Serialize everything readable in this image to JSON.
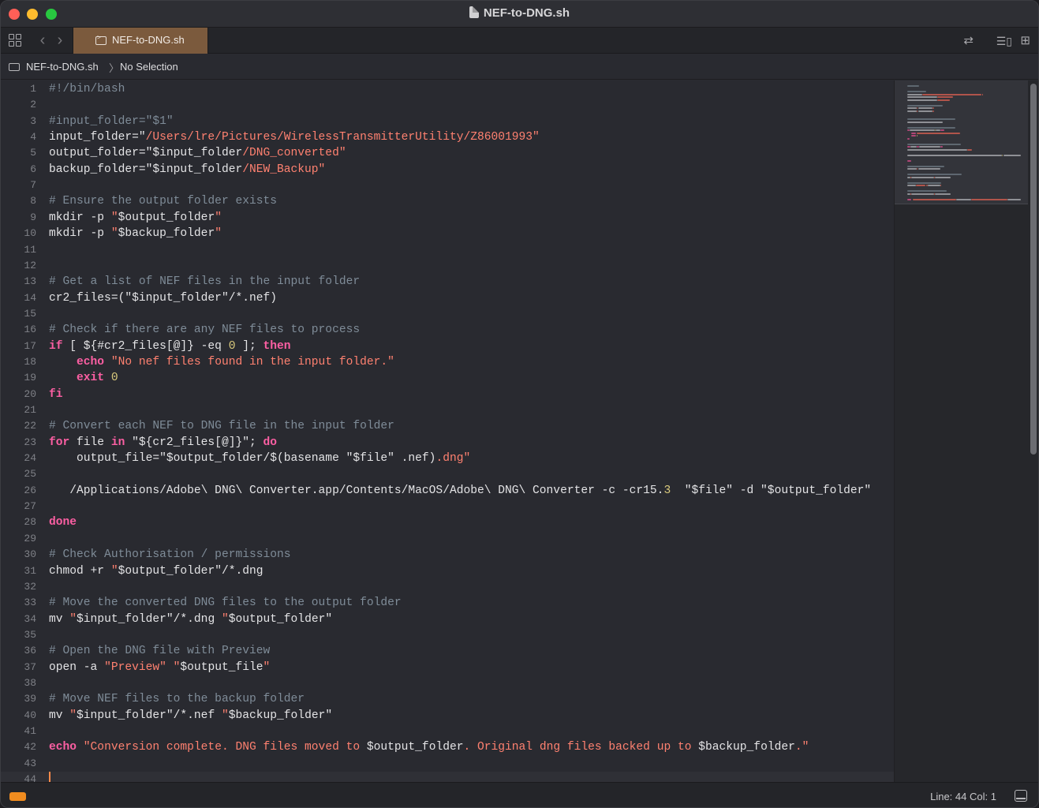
{
  "window": {
    "title": "NEF-to-DNG.sh"
  },
  "tabs": [
    {
      "label": "NEF-to-DNG.sh",
      "active": true
    }
  ],
  "breadcrumb": {
    "file": "NEF-to-DNG.sh",
    "separator": "〉",
    "selection": "No Selection"
  },
  "status": {
    "line_label": "Line:",
    "line": "44",
    "col_label": "Col:",
    "col": "1"
  },
  "colors": {
    "tab_active": "#7b5a3d",
    "comment": "#7f8c98",
    "string": "#ff8170",
    "keyword": "#fc5fa3",
    "number": "#d9c97c",
    "caret": "#ff8a4a"
  },
  "icons": [
    "document-icon",
    "grid-icon",
    "back-icon",
    "forward-icon",
    "terminal-file-icon",
    "swap-icon",
    "minimap-toggle-icon",
    "add-editor-icon",
    "panel-icon"
  ],
  "editor": {
    "current_line": 44,
    "lines": [
      {
        "n": "1",
        "tokens": [
          [
            "cmt",
            "#!/bin/bash"
          ]
        ]
      },
      {
        "n": "2",
        "tokens": []
      },
      {
        "n": "3",
        "tokens": [
          [
            "cmt",
            "#input_folder=\"$1\""
          ]
        ]
      },
      {
        "n": "4",
        "tokens": [
          [
            "pl",
            "input_folder=\""
          ],
          [
            "str",
            "/Users/lre/Pictures/WirelessTransmitterUtility/Z86001993"
          ],
          [
            "str",
            "\""
          ]
        ]
      },
      {
        "n": "5",
        "tokens": [
          [
            "pl",
            "output_folder=\"$input_folder"
          ],
          [
            "str",
            "/DNG_converted\""
          ]
        ]
      },
      {
        "n": "6",
        "tokens": [
          [
            "pl",
            "backup_folder=\"$input_folder"
          ],
          [
            "str",
            "/NEW_Backup\""
          ]
        ]
      },
      {
        "n": "7",
        "tokens": []
      },
      {
        "n": "8",
        "tokens": [
          [
            "cmt",
            "# Ensure the output folder exists"
          ]
        ]
      },
      {
        "n": "9",
        "tokens": [
          [
            "pl",
            "mkdir -p "
          ],
          [
            "str",
            "\""
          ],
          [
            "pl",
            "$output_folder"
          ],
          [
            "str",
            "\""
          ]
        ]
      },
      {
        "n": "10",
        "tokens": [
          [
            "pl",
            "mkdir -p "
          ],
          [
            "str",
            "\""
          ],
          [
            "pl",
            "$backup_folder"
          ],
          [
            "str",
            "\""
          ]
        ]
      },
      {
        "n": "11",
        "tokens": []
      },
      {
        "n": "12",
        "tokens": []
      },
      {
        "n": "13",
        "tokens": [
          [
            "cmt",
            "# Get a list of NEF files in the input folder"
          ]
        ]
      },
      {
        "n": "14",
        "tokens": [
          [
            "pl",
            "cr2_files=(\"$input_folder\"/*.nef)"
          ]
        ]
      },
      {
        "n": "15",
        "tokens": []
      },
      {
        "n": "16",
        "tokens": [
          [
            "cmt",
            "# Check if there are any NEF files to process"
          ]
        ]
      },
      {
        "n": "17",
        "tokens": [
          [
            "kw",
            "if"
          ],
          [
            "pl",
            " [ ${#cr2_files[@]} -eq "
          ],
          [
            "num",
            "0"
          ],
          [
            "pl",
            " ]; "
          ],
          [
            "kw",
            "then"
          ]
        ]
      },
      {
        "n": "18",
        "tokens": [
          [
            "pl",
            "    "
          ],
          [
            "kw",
            "echo"
          ],
          [
            "pl",
            " "
          ],
          [
            "str",
            "\"No nef files found in the input folder.\""
          ]
        ]
      },
      {
        "n": "19",
        "tokens": [
          [
            "pl",
            "    "
          ],
          [
            "kw",
            "exit"
          ],
          [
            "pl",
            " "
          ],
          [
            "num",
            "0"
          ]
        ]
      },
      {
        "n": "20",
        "tokens": [
          [
            "kw",
            "fi"
          ]
        ]
      },
      {
        "n": "21",
        "tokens": []
      },
      {
        "n": "22",
        "tokens": [
          [
            "cmt",
            "# Convert each NEF to DNG file in the input folder"
          ]
        ]
      },
      {
        "n": "23",
        "tokens": [
          [
            "kw",
            "for"
          ],
          [
            "pl",
            " file "
          ],
          [
            "kw",
            "in"
          ],
          [
            "pl",
            " \"${cr2_files[@]}\"; "
          ],
          [
            "kw",
            "do"
          ]
        ]
      },
      {
        "n": "24",
        "tokens": [
          [
            "pl",
            "    output_file=\"$output_folder/$(basename \"$file\" .nef)"
          ],
          [
            "str",
            ".dng\""
          ]
        ]
      },
      {
        "n": "25",
        "tokens": []
      },
      {
        "n": "26",
        "tokens": [
          [
            "pl",
            "   /Applications/Adobe\\ DNG\\ Converter.app/Contents/MacOS/Adobe\\ DNG\\ Converter -c -cr15."
          ],
          [
            "num",
            "3"
          ],
          [
            "pl",
            "  \"$file\" -d \"$output_folder\""
          ]
        ]
      },
      {
        "n": "27",
        "tokens": []
      },
      {
        "n": "28",
        "tokens": [
          [
            "kw",
            "done"
          ]
        ]
      },
      {
        "n": "29",
        "tokens": []
      },
      {
        "n": "30",
        "tokens": [
          [
            "cmt",
            "# Check Authorisation / permissions"
          ]
        ]
      },
      {
        "n": "31",
        "tokens": [
          [
            "pl",
            "chmod +r "
          ],
          [
            "str",
            "\""
          ],
          [
            "pl",
            "$output_folder\"/*.dng"
          ]
        ]
      },
      {
        "n": "32",
        "tokens": []
      },
      {
        "n": "33",
        "tokens": [
          [
            "cmt",
            "# Move the converted DNG files to the output folder"
          ]
        ]
      },
      {
        "n": "34",
        "tokens": [
          [
            "pl",
            "mv "
          ],
          [
            "str",
            "\""
          ],
          [
            "pl",
            "$input_folder\"/*.dng "
          ],
          [
            "str",
            "\""
          ],
          [
            "pl",
            "$output_folder\""
          ]
        ]
      },
      {
        "n": "35",
        "tokens": []
      },
      {
        "n": "36",
        "tokens": [
          [
            "cmt",
            "# Open the DNG file with Preview"
          ]
        ]
      },
      {
        "n": "37",
        "tokens": [
          [
            "pl",
            "open -a "
          ],
          [
            "str",
            "\"Preview\""
          ],
          [
            "pl",
            " "
          ],
          [
            "str",
            "\""
          ],
          [
            "pl",
            "$output_file"
          ],
          [
            "str",
            "\""
          ]
        ]
      },
      {
        "n": "38",
        "tokens": []
      },
      {
        "n": "39",
        "tokens": [
          [
            "cmt",
            "# Move NEF files to the backup folder"
          ]
        ]
      },
      {
        "n": "40",
        "tokens": [
          [
            "pl",
            "mv "
          ],
          [
            "str",
            "\""
          ],
          [
            "pl",
            "$input_folder\"/*.nef "
          ],
          [
            "str",
            "\""
          ],
          [
            "pl",
            "$backup_folder\""
          ]
        ]
      },
      {
        "n": "41",
        "tokens": []
      },
      {
        "n": "42",
        "tokens": [
          [
            "kw",
            "echo"
          ],
          [
            "pl",
            " "
          ],
          [
            "str",
            "\"Conversion complete. DNG files moved to "
          ],
          [
            "pl",
            "$output_folder"
          ],
          [
            "str",
            ". Original dng files backed up to "
          ],
          [
            "pl",
            "$backup_folder"
          ],
          [
            "str",
            ".\""
          ]
        ]
      },
      {
        "n": "43",
        "tokens": []
      },
      {
        "n": "44",
        "tokens": []
      }
    ]
  }
}
